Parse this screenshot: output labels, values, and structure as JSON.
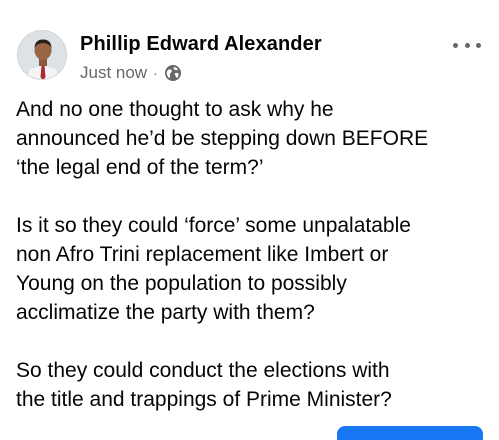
{
  "post": {
    "author": "Phillip Edward Alexander",
    "timestamp": "Just now",
    "separator": "·",
    "privacy_icon": "globe-icon",
    "more_icon": "more-options-icon",
    "paragraphs": [
      "And no one thought to ask why he\nannounced he’d be stepping down BEFORE\n‘the legal end of the term?’",
      "Is it so they could ‘force’ some unpalatable\nnon Afro Trini replacement like Imbert or\nYoung on the population to possibly\nacclimatize the party with them?",
      "So they could conduct the elections with\nthe title and trappings of Prime Minister?"
    ]
  },
  "colors": {
    "text": "#050505",
    "secondary_text": "#65676b",
    "accent": "#1877f2"
  }
}
